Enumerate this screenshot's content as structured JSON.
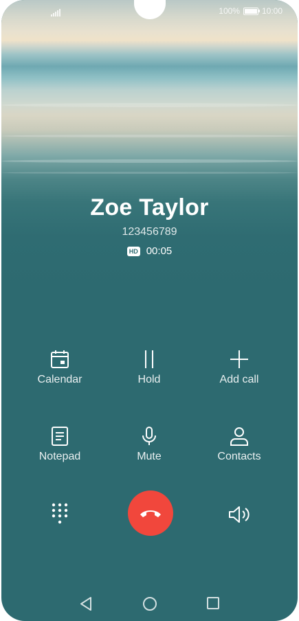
{
  "status_bar": {
    "battery_percent": "100%",
    "time": "10:00",
    "battery_level": 1.0
  },
  "call": {
    "caller_name": "Zoe Taylor",
    "number": "123456789",
    "hd_badge": "HD",
    "duration": "00:05"
  },
  "actions": {
    "calendar": "Calendar",
    "hold": "Hold",
    "add_call": "Add call",
    "notepad": "Notepad",
    "mute": "Mute",
    "contacts": "Contacts"
  },
  "colors": {
    "background": "#2d6a70",
    "end_call": "#f1473c"
  },
  "icons": [
    "signal-icon",
    "battery-icon",
    "calendar-icon",
    "pause-icon",
    "plus-icon",
    "notepad-icon",
    "microphone-icon",
    "contact-icon",
    "dialpad-icon",
    "end-call-icon",
    "speaker-icon",
    "back-icon",
    "home-icon",
    "recents-icon"
  ]
}
